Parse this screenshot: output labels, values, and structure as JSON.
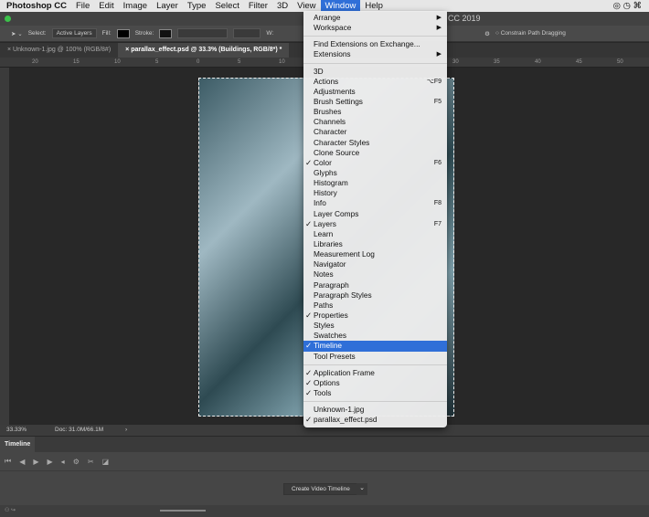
{
  "menubar": {
    "app": "Photoshop CC",
    "items": [
      "File",
      "Edit",
      "Image",
      "Layer",
      "Type",
      "Select",
      "Filter",
      "3D",
      "View",
      "Window",
      "Help"
    ],
    "active": "Window"
  },
  "title": "CC 2019",
  "options": {
    "select_label": "Select:",
    "select_value": "Active Layers",
    "fill_label": "Fill:",
    "stroke_label": "Stroke:",
    "w_label": "W:",
    "constrain": "Constrain Path Dragging"
  },
  "tabs": [
    {
      "label": "Unknown-1.jpg @ 100% (RGB/8#)",
      "active": false
    },
    {
      "label": "parallax_effect.psd @ 33.3% (Buildings, RGB/8*) *",
      "active": true
    }
  ],
  "ruler_ticks": [
    "20",
    "15",
    "10",
    "5",
    "0",
    "5",
    "10",
    "30",
    "35",
    "40",
    "45",
    "50"
  ],
  "status": {
    "zoom": "33.33%",
    "doc": "Doc: 31.0M/66.1M"
  },
  "timeline": {
    "tab": "Timeline",
    "create_button": "Create Video Timeline"
  },
  "window_menu": [
    {
      "label": "Arrange",
      "submenu": true
    },
    {
      "label": "Workspace",
      "submenu": true
    },
    {
      "sep": true
    },
    {
      "label": "Find Extensions on Exchange..."
    },
    {
      "label": "Extensions",
      "submenu": true
    },
    {
      "sep": true
    },
    {
      "label": "3D"
    },
    {
      "label": "Actions",
      "shortcut": "⌥F9"
    },
    {
      "label": "Adjustments"
    },
    {
      "label": "Brush Settings",
      "shortcut": "F5"
    },
    {
      "label": "Brushes"
    },
    {
      "label": "Channels"
    },
    {
      "label": "Character"
    },
    {
      "label": "Character Styles"
    },
    {
      "label": "Clone Source"
    },
    {
      "label": "Color",
      "shortcut": "F6",
      "checked": true
    },
    {
      "label": "Glyphs"
    },
    {
      "label": "Histogram"
    },
    {
      "label": "History"
    },
    {
      "label": "Info",
      "shortcut": "F8"
    },
    {
      "label": "Layer Comps"
    },
    {
      "label": "Layers",
      "shortcut": "F7",
      "checked": true
    },
    {
      "label": "Learn"
    },
    {
      "label": "Libraries"
    },
    {
      "label": "Measurement Log"
    },
    {
      "label": "Navigator"
    },
    {
      "label": "Notes"
    },
    {
      "label": "Paragraph"
    },
    {
      "label": "Paragraph Styles"
    },
    {
      "label": "Paths"
    },
    {
      "label": "Properties",
      "checked": true
    },
    {
      "label": "Styles"
    },
    {
      "label": "Swatches"
    },
    {
      "label": "Timeline",
      "checked": true,
      "highlighted": true
    },
    {
      "label": "Tool Presets"
    },
    {
      "sep": true
    },
    {
      "label": "Application Frame",
      "checked": true
    },
    {
      "label": "Options",
      "checked": true
    },
    {
      "label": "Tools",
      "checked": true
    },
    {
      "sep": true
    },
    {
      "label": "Unknown-1.jpg"
    },
    {
      "label": "parallax_effect.psd",
      "checked": true
    }
  ],
  "colors": {
    "accent": "#2f6fd8"
  }
}
